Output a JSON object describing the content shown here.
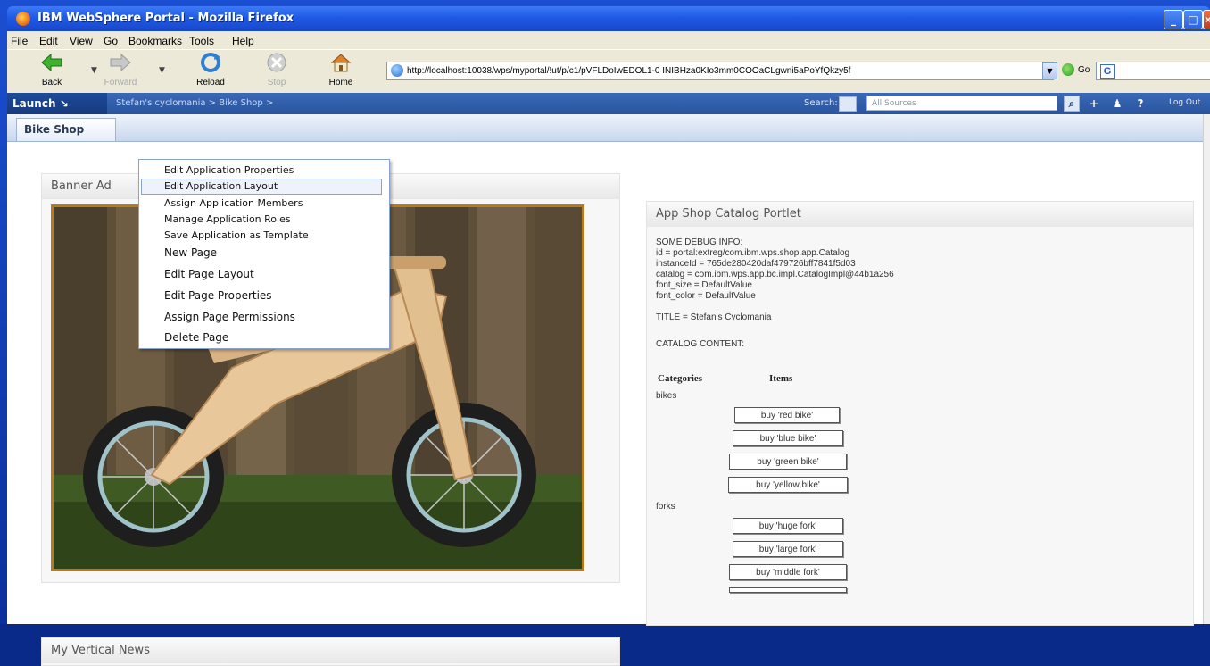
{
  "window": {
    "title": "IBM WebSphere Portal - Mozilla Firefox"
  },
  "menubar": [
    "File",
    "Edit",
    "View",
    "Go",
    "Bookmarks",
    "Tools",
    "Help"
  ],
  "toolbar": {
    "back": "Back",
    "forward": "Forward",
    "reload": "Reload",
    "stop": "Stop",
    "home": "Home",
    "url": "http://localhost:10038/wps/myportal/!ut/p/c1/pVFLDoIwEDOL1-0 INIBHza0KIo3mm0COOaCLgwni5aPoYfQkzy5f",
    "go": "Go"
  },
  "portal": {
    "launch": "Launch",
    "breadcrumb": "Stefan's cyclomania > Bike Shop >",
    "search_label": "Search:",
    "search_scope": "All Sources",
    "help": "?",
    "logout": "Log Out"
  },
  "page_tab": "Bike Shop",
  "menu": {
    "items": [
      "Edit Application Properties",
      "Edit Application Layout",
      "Assign Application Members",
      "Manage Application Roles",
      "Save Application as Template",
      "New Page",
      "Edit Page Layout",
      "Edit Page Properties",
      "Assign Page Permissions",
      "Delete Page"
    ]
  },
  "banner_portlet": {
    "title": "Banner Ad"
  },
  "news_portlet": {
    "title": "My Vertical News"
  },
  "catalog": {
    "title": "App Shop Catalog Portlet",
    "debug_header": "SOME DEBUG INFO:",
    "debug_lines": [
      "id = portal:extreg/com.ibm.wps.shop.app.Catalog",
      "instanceId = 765de280420daf479726bff7841f5d03",
      "catalog = com.ibm.wps.app.bc.impl.CatalogImpl@44b1a256",
      "font_size = DefaultValue",
      "font_color = DefaultValue"
    ],
    "title_line": "TITLE = Stefan's Cyclomania",
    "content_label": "CATALOG CONTENT:",
    "col_categories": "Categories",
    "col_items": "Items",
    "cat_bikes": "bikes",
    "cat_forks": "forks",
    "bike_buttons": [
      "buy 'red bike'",
      "buy 'blue bike'",
      "buy 'green bike'",
      "buy 'yellow bike'"
    ],
    "fork_buttons": [
      "buy 'huge fork'",
      "buy 'large fork'",
      "buy 'middle fork'"
    ]
  }
}
